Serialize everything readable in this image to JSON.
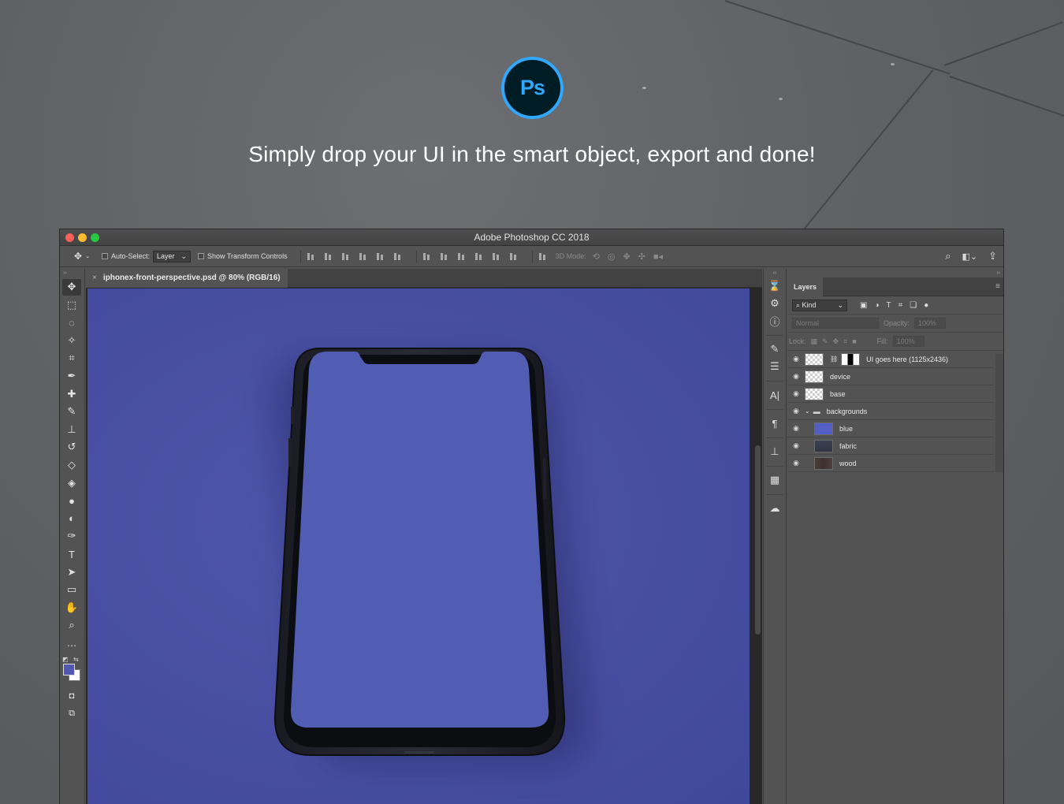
{
  "headline": "Simply drop your UI in the smart object, export and done!",
  "logo_text": "Ps",
  "window": {
    "title": "Adobe Photoshop CC 2018"
  },
  "options_bar": {
    "auto_select_label": "Auto-Select:",
    "auto_select_value": "Layer",
    "show_transform_label": "Show Transform Controls",
    "mode_3d_label": "3D Mode:"
  },
  "document": {
    "tab_title": "iphonex-front-perspective.psd @ 80% (RGB/16)",
    "close_glyph": "×"
  },
  "tools": [
    {
      "name": "move-tool",
      "glyph": "✥",
      "active": true
    },
    {
      "name": "marquee-tool",
      "glyph": "⬚"
    },
    {
      "name": "lasso-tool",
      "glyph": "◌"
    },
    {
      "name": "magic-wand-tool",
      "glyph": "✧"
    },
    {
      "name": "crop-tool",
      "glyph": "⌗"
    },
    {
      "name": "eyedropper-tool",
      "glyph": "✒"
    },
    {
      "name": "healing-brush-tool",
      "glyph": "✚"
    },
    {
      "name": "brush-tool",
      "glyph": "✎"
    },
    {
      "name": "clone-stamp-tool",
      "glyph": "⊥"
    },
    {
      "name": "history-brush-tool",
      "glyph": "↺"
    },
    {
      "name": "eraser-tool",
      "glyph": "◇"
    },
    {
      "name": "paint-bucket-tool",
      "glyph": "◈"
    },
    {
      "name": "blur-tool",
      "glyph": "●"
    },
    {
      "name": "dodge-tool",
      "glyph": "◐"
    },
    {
      "name": "pen-tool",
      "glyph": "✑"
    },
    {
      "name": "type-tool",
      "glyph": "T"
    },
    {
      "name": "path-selection-tool",
      "glyph": "➤"
    },
    {
      "name": "rectangle-tool",
      "glyph": "▭"
    },
    {
      "name": "hand-tool",
      "glyph": "✋"
    },
    {
      "name": "zoom-tool",
      "glyph": "⌕"
    },
    {
      "name": "more-tools",
      "glyph": "…"
    }
  ],
  "colors": {
    "foreground": "#5058b2",
    "background": "#ffffff",
    "artboard": "#4a52a8",
    "ps_blue": "#31a8ff"
  },
  "layers_panel": {
    "tab_label": "Layers",
    "kind_label": "Kind",
    "blend_mode": "Normal",
    "opacity_label": "Opacity:",
    "opacity_value": "100%",
    "lock_label": "Lock:",
    "fill_label": "Fill:",
    "fill_value": "100%",
    "layers": [
      {
        "name": "UI goes here (1125x2436)",
        "thumb": "check",
        "smart": true,
        "indent": 0
      },
      {
        "name": "device",
        "thumb": "check",
        "indent": 0
      },
      {
        "name": "base",
        "thumb": "check",
        "indent": 0
      },
      {
        "name": "backgrounds",
        "thumb": "folder",
        "indent": 0
      },
      {
        "name": "blue",
        "thumb": "blue",
        "indent": 1
      },
      {
        "name": "fabric",
        "thumb": "fabric",
        "indent": 1
      },
      {
        "name": "wood",
        "thumb": "wood",
        "indent": 1
      }
    ]
  }
}
